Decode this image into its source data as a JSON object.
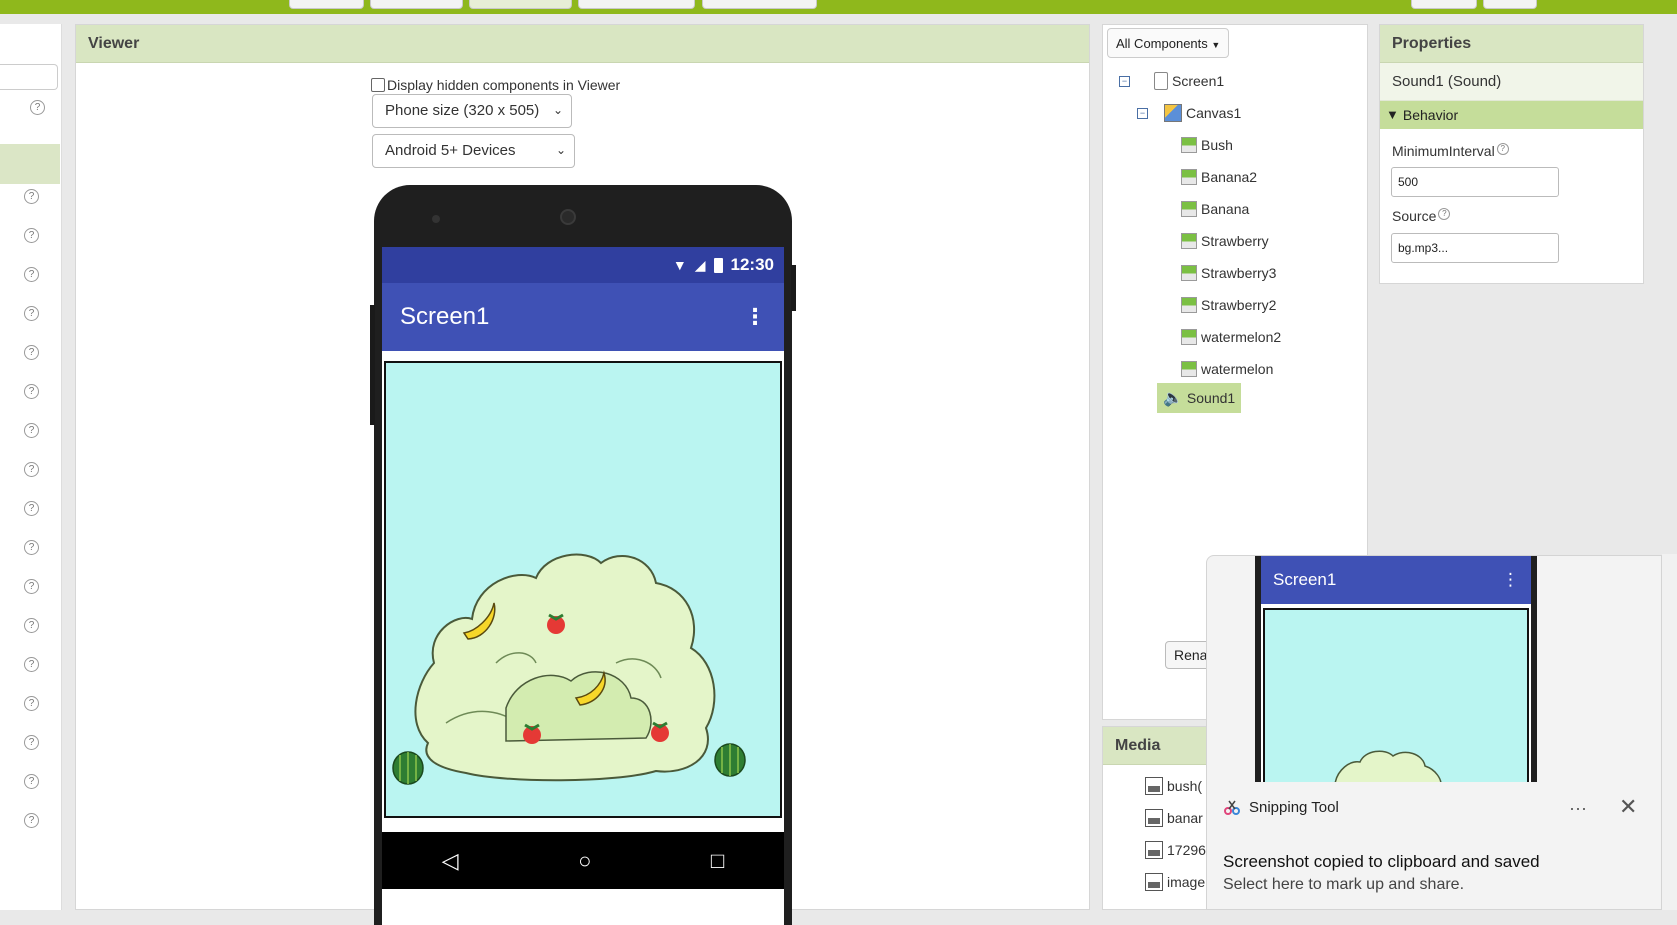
{
  "viewer": {
    "header": "Viewer",
    "display_hidden_label": "Display hidden components in Viewer",
    "phone_size": "Phone size (320 x 505)",
    "device_type": "Android 5+ Devices"
  },
  "phone": {
    "time": "12:30",
    "screen_title": "Screen1",
    "menu_glyph": "⋮",
    "nav_back": "◁",
    "nav_home": "○",
    "nav_recent": "□"
  },
  "components": {
    "filter": "All Components",
    "tree": {
      "screen": "Screen1",
      "canvas": "Canvas1",
      "sprites": [
        "Bush",
        "Banana2",
        "Banana",
        "Strawberry",
        "Strawberry3",
        "Strawberry2",
        "watermelon2",
        "watermelon"
      ],
      "sound": "Sound1"
    },
    "rename_button": "Rena"
  },
  "media": {
    "header": "Media",
    "items": [
      "bush(",
      "banar",
      "17296",
      "image"
    ]
  },
  "properties": {
    "header": "Properties",
    "component": "Sound1 (Sound)",
    "section": "Behavior",
    "min_interval_label": "MinimumInterval",
    "min_interval_value": "500",
    "source_label": "Source",
    "source_value": "bg.mp3..."
  },
  "help_glyph": "?",
  "toast": {
    "app_name": "Snipping Tool",
    "message": "Screenshot copied to clipboard and saved",
    "submessage": "Select here to mark up and share.",
    "more": "···",
    "close": "✕",
    "preview_title": "Screen1",
    "preview_menu": "⋮"
  },
  "colors": {
    "accent_green": "#8fb81c",
    "header_green": "#d9e6c2",
    "selected_green": "#c5dd9a",
    "phone_statusbar": "#303f9f",
    "phone_appbar": "#3f51b5",
    "canvas_bg": "#baf5f1"
  }
}
